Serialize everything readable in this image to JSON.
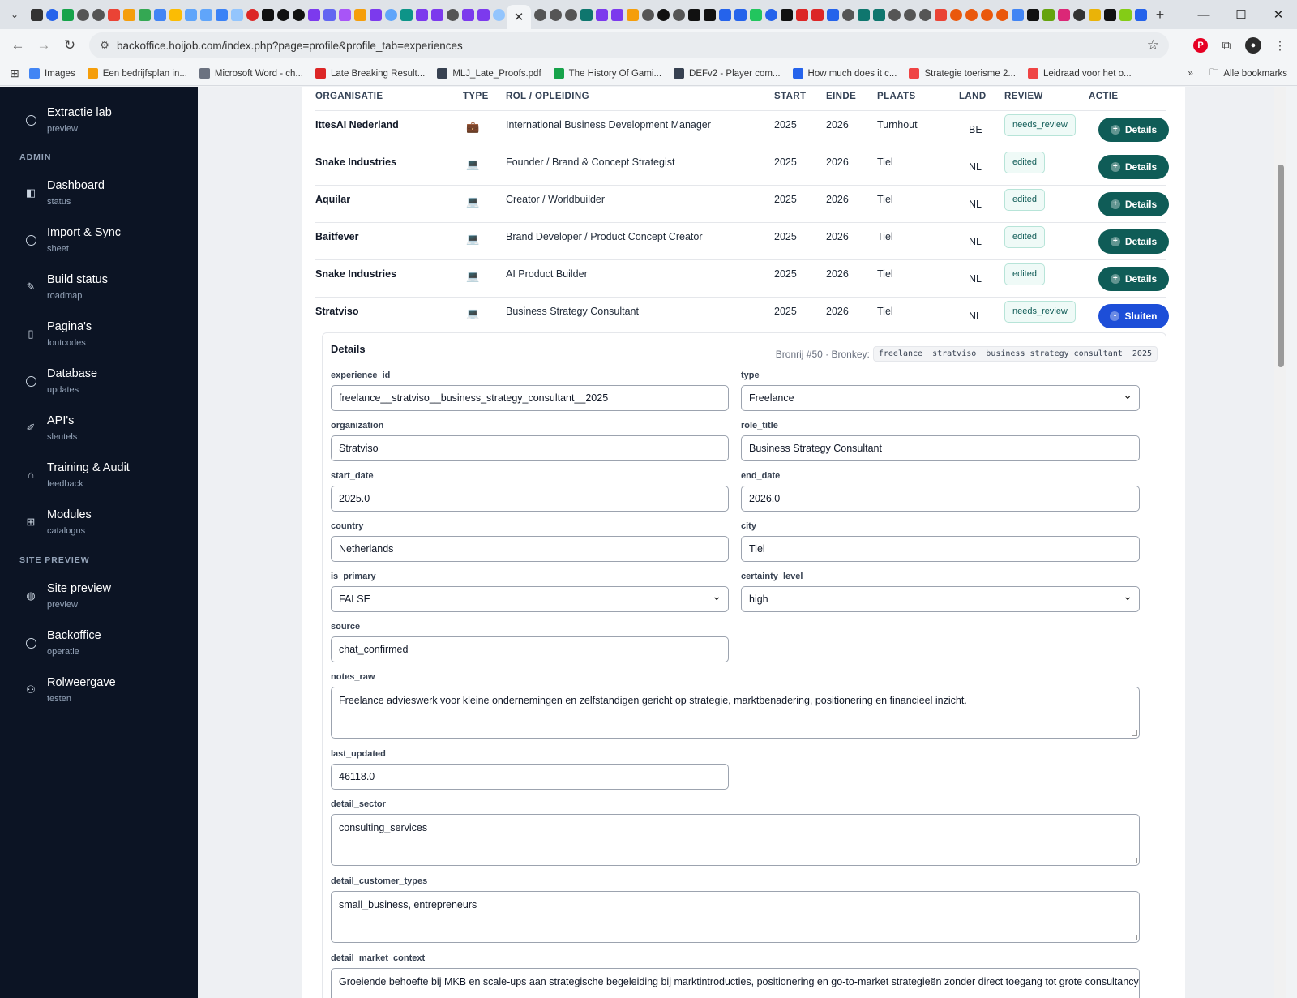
{
  "browser": {
    "url": "backoffice.hoijob.com/index.php?page=profile&profile_tab=experiences",
    "bookmarks": [
      {
        "label": "Images",
        "color": "#4285f4"
      },
      {
        "label": "Een bedrijfsplan in...",
        "color": "#f59e0b"
      },
      {
        "label": "Microsoft Word - ch...",
        "color": "#6b7280"
      },
      {
        "label": "Late Breaking Result...",
        "color": "#dc2626"
      },
      {
        "label": "MLJ_Late_Proofs.pdf",
        "color": "#374151"
      },
      {
        "label": "The History Of Gami...",
        "color": "#16a34a"
      },
      {
        "label": "DEFv2 - Player com...",
        "color": "#374151"
      },
      {
        "label": "How much does it c...",
        "color": "#2563eb"
      },
      {
        "label": "Strategie toerisme 2...",
        "color": "#ef4444"
      },
      {
        "label": "Leidraad voor het o...",
        "color": "#ef4444"
      }
    ],
    "all_bookmarks": "Alle bookmarks"
  },
  "sidebar": {
    "top_item": {
      "label": "Extractie lab",
      "sub": "preview"
    },
    "section_admin": "ADMIN",
    "admin_items": [
      {
        "label": "Dashboard",
        "sub": "status",
        "icon": "dashboard-icon"
      },
      {
        "label": "Import & Sync",
        "sub": "sheet",
        "icon": "circle-icon"
      },
      {
        "label": "Build status",
        "sub": "roadmap",
        "icon": "wrench-icon"
      },
      {
        "label": "Pagina's",
        "sub": "foutcodes",
        "icon": "page-icon"
      },
      {
        "label": "Database",
        "sub": "updates",
        "icon": "circle-icon"
      },
      {
        "label": "API's",
        "sub": "sleutels",
        "icon": "pencil-icon"
      },
      {
        "label": "Training & Audit",
        "sub": "feedback",
        "icon": "graduation-icon"
      },
      {
        "label": "Modules",
        "sub": "catalogus",
        "icon": "grid-icon"
      }
    ],
    "section_site": "SITE PREVIEW",
    "site_items": [
      {
        "label": "Site preview",
        "sub": "preview",
        "icon": "globe-icon"
      },
      {
        "label": "Backoffice",
        "sub": "operatie",
        "icon": "circle-icon"
      },
      {
        "label": "Rolweergave",
        "sub": "testen",
        "icon": "users-icon"
      }
    ]
  },
  "table": {
    "headers": {
      "org": "ORGANISATIE",
      "type": "TYPE",
      "role": "ROL / OPLEIDING",
      "start": "START",
      "end": "EINDE",
      "place": "PLAATS",
      "country": "LAND",
      "review": "REVIEW",
      "action": "ACTIE"
    },
    "rows": [
      {
        "org": "IttesAI Nederland",
        "type_icon": "💼",
        "role": "International Business Development Manager",
        "start": "2025",
        "end": "2026",
        "place": "Turnhout",
        "country": "BE",
        "review": "needs_review",
        "action": "Details"
      },
      {
        "org": "Snake Industries",
        "type_icon": "💻",
        "role": "Founder / Brand & Concept Strategist",
        "start": "2025",
        "end": "2026",
        "place": "Tiel",
        "country": "NL",
        "review": "edited",
        "action": "Details"
      },
      {
        "org": "Aquilar",
        "type_icon": "💻",
        "role": "Creator / Worldbuilder",
        "start": "2025",
        "end": "2026",
        "place": "Tiel",
        "country": "NL",
        "review": "edited",
        "action": "Details"
      },
      {
        "org": "Baitfever",
        "type_icon": "💻",
        "role": "Brand Developer / Product Concept Creator",
        "start": "2025",
        "end": "2026",
        "place": "Tiel",
        "country": "NL",
        "review": "edited",
        "action": "Details"
      },
      {
        "org": "Snake Industries",
        "type_icon": "💻",
        "role": "AI Product Builder",
        "start": "2025",
        "end": "2026",
        "place": "Tiel",
        "country": "NL",
        "review": "edited",
        "action": "Details"
      },
      {
        "org": "Stratviso",
        "type_icon": "💻",
        "role": "Business Strategy Consultant",
        "start": "2025",
        "end": "2026",
        "place": "Tiel",
        "country": "NL",
        "review": "needs_review",
        "action": "Sluiten"
      }
    ]
  },
  "details": {
    "title": "Details",
    "source_row": "Bronrij #50 · Bronkey:",
    "source_key": "freelance__stratviso__business_strategy_consultant__2025",
    "fields": {
      "experience_id": {
        "label": "experience_id",
        "value": "freelance__stratviso__business_strategy_consultant__2025"
      },
      "type": {
        "label": "type",
        "value": "Freelance"
      },
      "organization": {
        "label": "organization",
        "value": "Stratviso"
      },
      "role_title": {
        "label": "role_title",
        "value": "Business Strategy Consultant"
      },
      "start_date": {
        "label": "start_date",
        "value": "2025.0"
      },
      "end_date": {
        "label": "end_date",
        "value": "2026.0"
      },
      "country": {
        "label": "country",
        "value": "Netherlands"
      },
      "city": {
        "label": "city",
        "value": "Tiel"
      },
      "is_primary": {
        "label": "is_primary",
        "value": "FALSE"
      },
      "certainty_level": {
        "label": "certainty_level",
        "value": "high"
      },
      "source": {
        "label": "source",
        "value": "chat_confirmed"
      },
      "notes_raw": {
        "label": "notes_raw",
        "value": "Freelance advieswerk voor kleine ondernemingen en zelfstandigen gericht op strategie, marktbenadering, positionering en financieel inzicht."
      },
      "last_updated": {
        "label": "last_updated",
        "value": "46118.0"
      },
      "detail_sector": {
        "label": "detail_sector",
        "value": "consulting_services"
      },
      "detail_customer_types": {
        "label": "detail_customer_types",
        "value": "small_business, entrepreneurs"
      },
      "detail_market_context": {
        "label": "detail_market_context",
        "value": "Groeiende behoefte bij MKB en scale-ups aan strategische begeleiding bij marktintroducties, positionering en go-to-market strategieën zonder direct toegang tot grote consultancybureaus."
      }
    }
  },
  "colors": {
    "sidebar_bg": "#0c1424",
    "details_button": "#0f5c57",
    "close_button": "#1d4ed8",
    "badge_bg": "#effaf7"
  }
}
